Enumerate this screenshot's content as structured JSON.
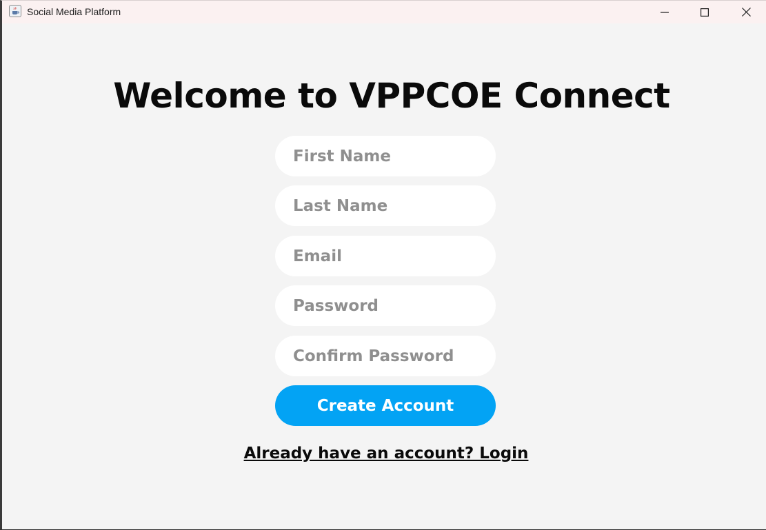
{
  "window": {
    "title": "Social Media Platform"
  },
  "form": {
    "heading": "Welcome to VPPCOE Connect",
    "first_name_placeholder": "First Name",
    "last_name_placeholder": "Last Name",
    "email_placeholder": "Email",
    "password_placeholder": "Password",
    "confirm_password_placeholder": "Confirm Password",
    "create_account_label": "Create Account",
    "login_link_label": "Already have an account? Login"
  },
  "colors": {
    "background": "#f4f4f4",
    "titlebar": "#fbf1f1",
    "accent": "#03a3f4",
    "field": "#ffffff",
    "placeholder": "#8f8f8f"
  },
  "icons": {
    "app": "java-cup-icon",
    "minimize": "minimize-icon",
    "maximize": "maximize-icon",
    "close": "close-icon"
  }
}
